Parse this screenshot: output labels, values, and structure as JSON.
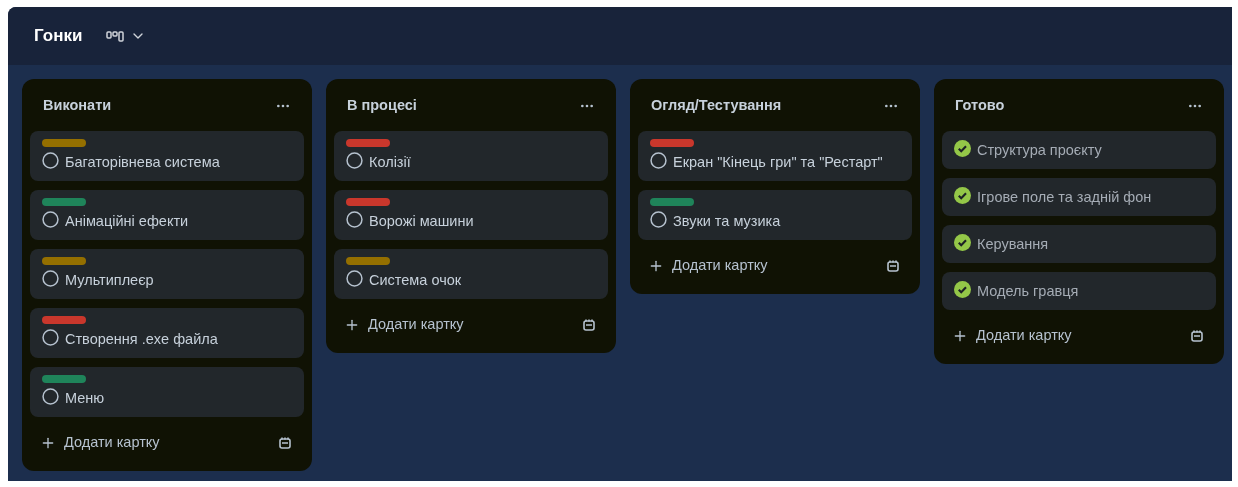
{
  "board": {
    "title": "Гонки"
  },
  "lists": [
    {
      "title": "Виконати",
      "cards": [
        {
          "title": "Багаторівнева система",
          "color": "#946f00",
          "completed": false
        },
        {
          "title": "Анімаційні ефекти",
          "color": "#1f845a",
          "completed": false
        },
        {
          "title": "Мультиплеєр",
          "color": "#946f00",
          "completed": false
        },
        {
          "title": "Створення .exe файла",
          "color": "#c9372c",
          "completed": false
        },
        {
          "title": "Меню",
          "color": "#1f845a",
          "completed": false
        }
      ],
      "add_label": "Додати картку"
    },
    {
      "title": "В процесі",
      "cards": [
        {
          "title": "Колізії",
          "color": "#c9372c",
          "completed": false
        },
        {
          "title": "Ворожі машини",
          "color": "#c9372c",
          "completed": false
        },
        {
          "title": "Система очок",
          "color": "#946f00",
          "completed": false
        }
      ],
      "add_label": "Додати картку"
    },
    {
      "title": "Огляд/Тестування",
      "cards": [
        {
          "title": "Екран \"Кінець гри\" та \"Рестарт\"",
          "color": "#c9372c",
          "completed": false
        },
        {
          "title": "Звуки та музика",
          "color": "#1f845a",
          "completed": false
        }
      ],
      "add_label": "Додати картку"
    },
    {
      "title": "Готово",
      "cards": [
        {
          "title": "Структура проєкту",
          "completed": true
        },
        {
          "title": "Ігрове поле та задній фон",
          "completed": true
        },
        {
          "title": "Керування",
          "completed": true
        },
        {
          "title": "Модель гравця",
          "completed": true
        }
      ],
      "add_label": "Додати картку"
    }
  ]
}
